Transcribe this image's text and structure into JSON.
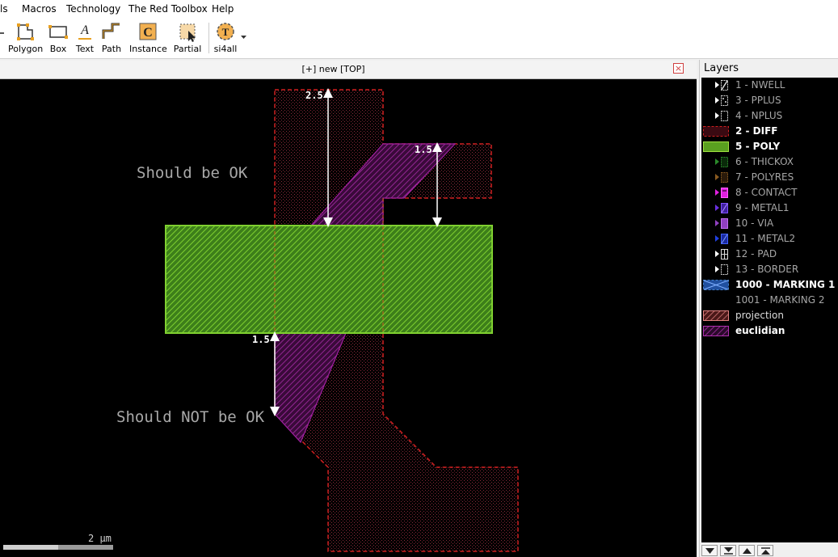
{
  "menu": [
    "ls",
    "Macros",
    "Technology",
    "The Red Toolbox",
    "Help"
  ],
  "toolbar": [
    {
      "label": "Polygon",
      "icon": "polygon-icon"
    },
    {
      "label": "Box",
      "icon": "box-icon"
    },
    {
      "label": "Text",
      "icon": "text-icon"
    },
    {
      "label": "Path",
      "icon": "path-icon"
    },
    {
      "label": "Instance",
      "icon": "instance-icon"
    },
    {
      "label": "Partial",
      "icon": "partial-icon"
    },
    {
      "label": "si4all",
      "icon": "si4all-icon"
    }
  ],
  "tool_glyphs": {
    "text": "A",
    "instance": "C",
    "si4all": "T"
  },
  "canvas": {
    "title": "[+] new [TOP]",
    "close_glyph": "×",
    "label_ok": "Should be OK",
    "label_not_ok": "Should NOT be OK",
    "dim_top": "2.5",
    "dim_right": "1.5",
    "dim_bottom": "1.5",
    "scale": "2 µm"
  },
  "layers": {
    "title": "Layers",
    "items": [
      {
        "label": "1 - NWELL",
        "style": "dim",
        "arrow": true
      },
      {
        "label": "3 - PPLUS",
        "style": "dim",
        "arrow": true
      },
      {
        "label": "4 - NPLUS",
        "style": "dim",
        "arrow": true
      },
      {
        "label": "2 - DIFF",
        "style": "bold",
        "arrow": false
      },
      {
        "label": "5 - POLY",
        "style": "bold",
        "arrow": false
      },
      {
        "label": "6 - THICKOX",
        "style": "dim",
        "arrow": true
      },
      {
        "label": "7 - POLYRES",
        "style": "dim",
        "arrow": true
      },
      {
        "label": "8 - CONTACT",
        "style": "dim",
        "arrow": true
      },
      {
        "label": "9 - METAL1",
        "style": "dim",
        "arrow": true
      },
      {
        "label": "10 - VIA",
        "style": "dim",
        "arrow": true
      },
      {
        "label": "11 - METAL2",
        "style": "dim",
        "arrow": true
      },
      {
        "label": "12 - PAD",
        "style": "dim",
        "arrow": true
      },
      {
        "label": "13 - BORDER",
        "style": "dim",
        "arrow": true
      },
      {
        "label": "1000 - MARKING 1",
        "style": "bold",
        "arrow": false
      },
      {
        "label": "1001 - MARKING 2",
        "style": "dim",
        "arrow": false
      },
      {
        "label": "projection",
        "style": "normal",
        "arrow": false
      },
      {
        "label": "euclidian",
        "style": "bold",
        "arrow": false
      }
    ]
  },
  "colors": {
    "diff": "#c0203a",
    "poly": "#6cc020",
    "euclidian": "#b030b0",
    "projection": "#e08080"
  }
}
